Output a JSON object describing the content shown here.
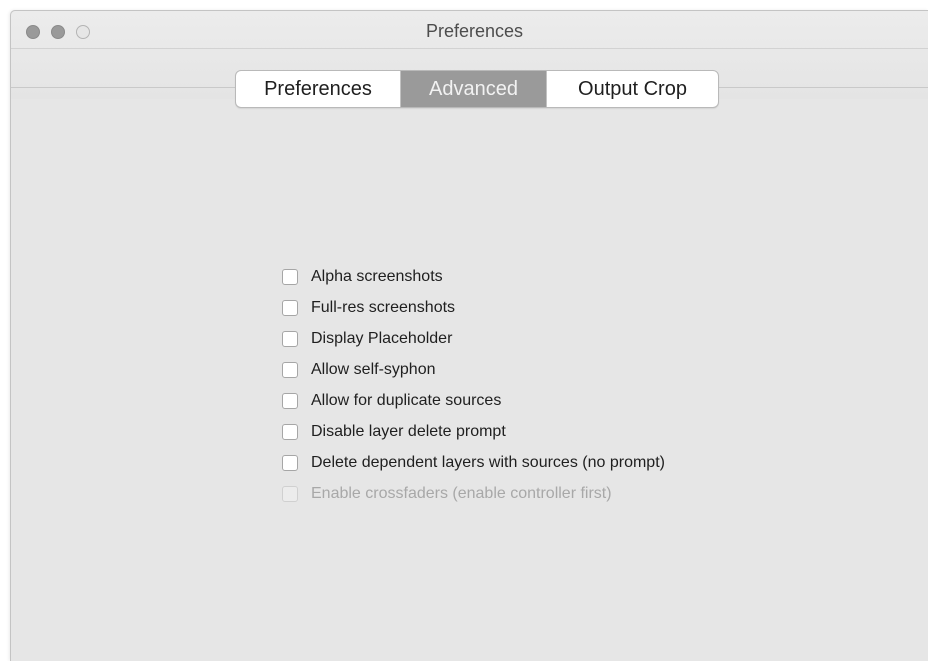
{
  "window": {
    "title": "Preferences"
  },
  "tabs": [
    {
      "label": "Preferences",
      "selected": false
    },
    {
      "label": "Advanced",
      "selected": true
    },
    {
      "label": "Output Crop",
      "selected": false
    }
  ],
  "options": [
    {
      "label": "Alpha screenshots",
      "checked": false,
      "enabled": true
    },
    {
      "label": "Full-res screenshots",
      "checked": false,
      "enabled": true
    },
    {
      "label": "Display Placeholder",
      "checked": false,
      "enabled": true
    },
    {
      "label": "Allow self-syphon",
      "checked": false,
      "enabled": true
    },
    {
      "label": "Allow for duplicate sources",
      "checked": false,
      "enabled": true
    },
    {
      "label": "Disable layer delete prompt",
      "checked": false,
      "enabled": true
    },
    {
      "label": "Delete dependent layers with sources (no prompt)",
      "checked": false,
      "enabled": true
    },
    {
      "label": "Enable crossfaders (enable controller first)",
      "checked": false,
      "enabled": false
    }
  ]
}
